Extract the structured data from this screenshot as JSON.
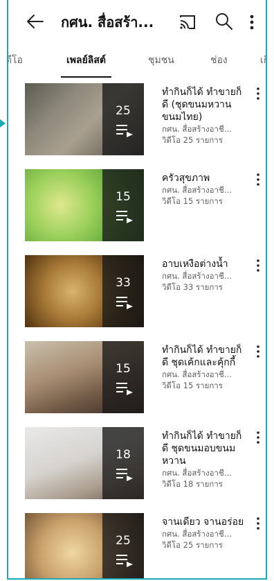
{
  "header": {
    "title": "กศน. สื่อสร้า...",
    "icons": [
      "back-arrow-icon",
      "cast-icon",
      "search-icon",
      "more-vert-icon"
    ]
  },
  "tabs": [
    {
      "label": "วิดีโอ",
      "active": false
    },
    {
      "label": "เพลย์ลิสต์",
      "active": true
    },
    {
      "label": "ชุมชน",
      "active": false
    },
    {
      "label": "ช่อง",
      "active": false
    },
    {
      "label": "เกี่",
      "active": false
    }
  ],
  "playlists": [
    {
      "title": "ทำกินก็ได้ ทำขายก็ดี (ชุดขนมหวานขนมไทย)",
      "channel": "กศน. สื่อสร้างอาชี...",
      "videos": "วิดีโอ 25 รายการ",
      "count": "25"
    },
    {
      "title": "ครัวสุขภาพ",
      "channel": "กศน. สื่อสร้างอาชี...",
      "videos": "วิดีโอ 15 รายการ",
      "count": "15"
    },
    {
      "title": "อาบเหงือต่างน้ำ",
      "channel": "กศน. สื่อสร้างอาชี...",
      "videos": "วิดีโอ 33 รายการ",
      "count": "33"
    },
    {
      "title": "ทำกินก็ได้ ทำขายก็ดี ชุดเค้กและคุ้กกี้",
      "channel": "กศน. สื่อสร้างอาชี...",
      "videos": "วิดีโอ 15 รายการ",
      "count": "15"
    },
    {
      "title": "ทำกินก็ได้ ทำขายก็ดี ชุดขนมอบขนมหวาน",
      "channel": "กศน. สื่อสร้างอาชี...",
      "videos": "วิดีโอ 18 รายการ",
      "count": "18"
    },
    {
      "title": "จานเดียว จานอร่อย",
      "channel": "กศน. สื่อสร้างอาชี...",
      "videos": "วิดีโอ 25 รายการ",
      "count": "25"
    }
  ],
  "colors": {
    "frame": "#1aa7b8",
    "text": "#111111",
    "meta": "#606060"
  }
}
